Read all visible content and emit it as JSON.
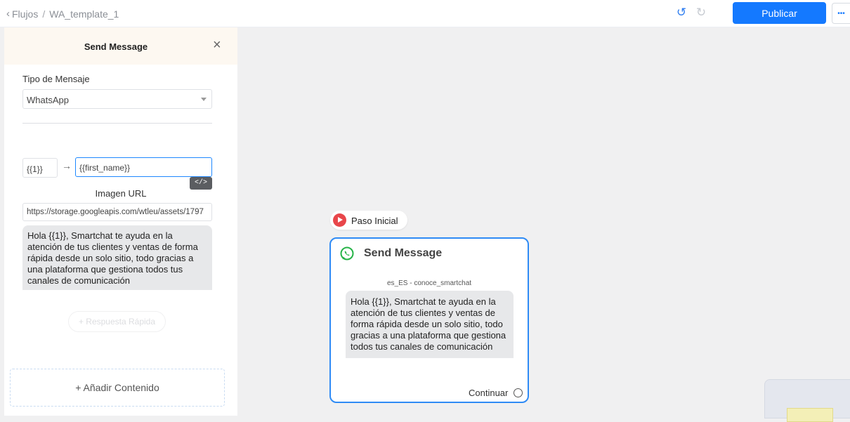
{
  "breadcrumb": {
    "root": "Flujos",
    "separator": "/",
    "current": "WA_template_1"
  },
  "toolbar": {
    "publish_label": "Publicar",
    "more_label": "•••"
  },
  "panel": {
    "title": "Send Message",
    "message_type_label": "Tipo de Mensaje",
    "message_type_value": "WhatsApp",
    "variable_key": "{{1}}",
    "variable_arrow": "→",
    "variable_value": "{{first_name}}",
    "code_button_label": "</>",
    "image_url_label": "Imagen URL",
    "image_url_value": "https://storage.googleapis.com/wtleu/assets/1797",
    "message_text": "Hola {{1}}, Smartchat te ayuda en la atención de tus clientes y ventas de forma rápida desde un solo sitio, todo gracias a una plataforma que gestiona todos tus canales de comunicación",
    "quick_reply_label": "+ Respuesta Rápida",
    "add_content_label": "+ Añadir Contenido"
  },
  "canvas": {
    "start_node_label": "Paso Inicial",
    "node": {
      "title": "Send Message",
      "template_name": "es_ES - conoce_smartchat",
      "message_text": "Hola {{1}}, Smartchat te ayuda en la atención de tus clientes y ventas de forma rápida desde un solo sitio, todo gracias a una plataforma que gestiona todos tus canales de comunicación",
      "continue_label": "Continuar"
    }
  },
  "colors": {
    "accent": "#1479ff",
    "node_border": "#2f8bf5",
    "whatsapp": "#25b347",
    "start": "#e8464a"
  }
}
